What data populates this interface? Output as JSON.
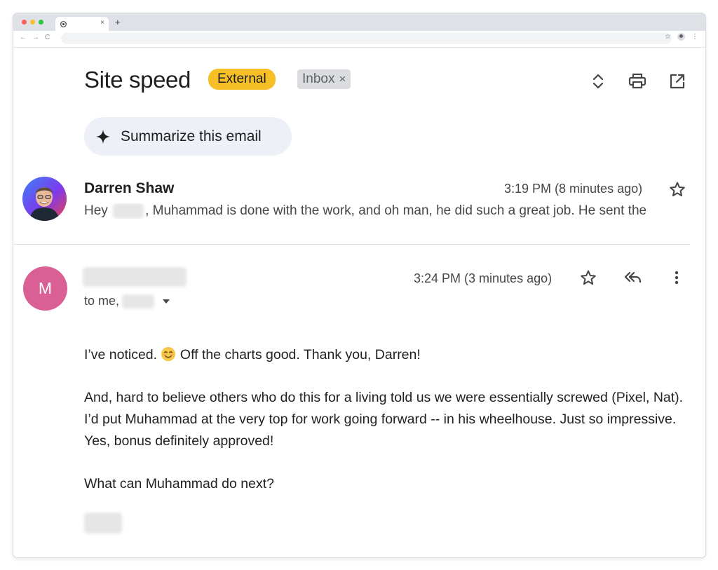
{
  "browser": {
    "tab_close": "×",
    "new_tab": "+",
    "nav_back": "←",
    "nav_forward": "→",
    "nav_reload": "C"
  },
  "email": {
    "subject": "Site speed",
    "labels": {
      "external": "External",
      "inbox": "Inbox",
      "remove": "×"
    },
    "summarize_label": "Summarize this email"
  },
  "messages": [
    {
      "sender": "Darren Shaw",
      "time": "3:19 PM (8 minutes ago)",
      "snippet_greeting": "Hey",
      "snippet_text": ", Muhammad is done with the work, and oh man, he did such a great job. He sent the"
    },
    {
      "avatar_letter": "M",
      "avatar_color": "#d95f95",
      "time": "3:24 PM (3 minutes ago)",
      "recipients_prefix": "to me,",
      "body": {
        "line1_before_emoji": "I’ve noticed.",
        "line1_after_emoji": " Off the charts good.  Thank you, Darren!",
        "para2": "And, hard to believe others who do this for a living told us we were essentially screwed (Pixel, Nat).  I’d put Muhammad at the very top for work going forward -- in his wheelhouse.  Just so impressive.  Yes, bonus definitely approved!",
        "para3": "What can Muhammad do next?"
      }
    }
  ],
  "colors": {
    "external_chip": "#f6bf26",
    "inbox_chip": "#dadce0",
    "summarize_bg": "#eef0f8"
  }
}
